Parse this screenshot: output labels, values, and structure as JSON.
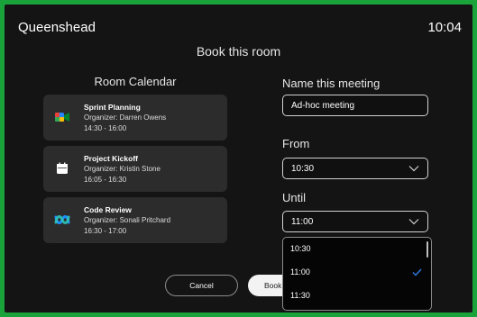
{
  "header": {
    "room_name": "Queenshead",
    "clock": "10:04"
  },
  "dialog": {
    "title": "Book this room"
  },
  "calendar": {
    "title": "Room Calendar",
    "meetings": [
      {
        "title": "Sprint Planning",
        "organizer": "Organizer: Darren Owens",
        "time": "14:30 - 16:00",
        "icon": "google-meet-icon"
      },
      {
        "title": "Project Kickoff",
        "organizer": "Organizer: Kristin Stone",
        "time": "16:05 - 16:30",
        "icon": "calendar-icon"
      },
      {
        "title": "Code Review",
        "organizer": "Organizer: Sonali Pritchard",
        "time": "16:30 - 17:00",
        "icon": "webex-icon"
      }
    ]
  },
  "form": {
    "name_label": "Name this meeting",
    "name_value": "Ad-hoc meeting",
    "from_label": "From",
    "from_value": "10:30",
    "until_label": "Until",
    "until_value": "11:00",
    "until_options": [
      "10:30",
      "11:00",
      "11:30"
    ],
    "until_selected": "11:00"
  },
  "buttons": {
    "cancel": "Cancel",
    "book": "Book"
  },
  "colors": {
    "border": "#1aa33a",
    "background": "#141414",
    "card": "#2c2c2c",
    "accent": "#2f7de1"
  }
}
